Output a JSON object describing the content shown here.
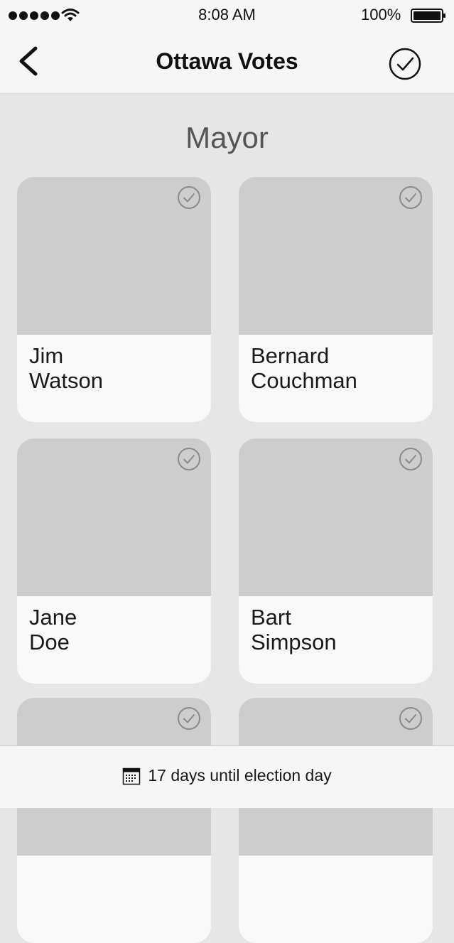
{
  "status_bar": {
    "time": "8:08 AM",
    "battery": "100%",
    "signal_icon": "signal-dots-icon",
    "wifi_icon": "wifi-icon",
    "battery_icon": "battery-icon"
  },
  "nav": {
    "title": "Ottawa Votes",
    "back_icon": "chevron-left-icon",
    "confirm_icon": "checkmark-circle-icon"
  },
  "section": {
    "title": "Mayor"
  },
  "candidates": [
    {
      "first": "Jim",
      "last": "Watson"
    },
    {
      "first": "Bernard",
      "last": "Couchman"
    },
    {
      "first": "Jane",
      "last": "Doe"
    },
    {
      "first": "Bart",
      "last": "Simpson"
    },
    {
      "first": "",
      "last": ""
    },
    {
      "first": "",
      "last": ""
    }
  ],
  "footer": {
    "text": "17 days until election day",
    "icon": "calendar-icon"
  },
  "colors": {
    "background": "#e6e6e6",
    "bar": "#f6f6f6",
    "photo_placeholder": "#cdcdcd",
    "card": "#f9f9f9",
    "section_title": "#555555"
  }
}
